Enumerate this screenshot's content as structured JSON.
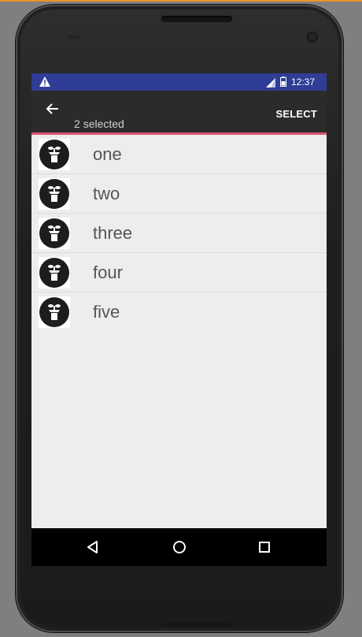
{
  "status_bar": {
    "time": "12:37",
    "warning_icon": "warning-icon",
    "signal_icon": "signal-icon",
    "battery_icon": "battery-icon",
    "background_color": "#2f3d97"
  },
  "action_bar": {
    "back_icon": "back-arrow-icon",
    "selected_count": "2",
    "selected_label": "selected",
    "select_label": "SELECT",
    "accent_color": "#e0536f"
  },
  "list": {
    "items": [
      {
        "label": "one",
        "icon": "plant-pot-icon"
      },
      {
        "label": "two",
        "icon": "plant-pot-icon"
      },
      {
        "label": "three",
        "icon": "plant-pot-icon"
      },
      {
        "label": "four",
        "icon": "plant-pot-icon"
      },
      {
        "label": "five",
        "icon": "plant-pot-icon"
      }
    ]
  },
  "nav_bar": {
    "back_icon": "nav-back-triangle-icon",
    "home_icon": "nav-home-circle-icon",
    "recents_icon": "nav-recents-square-icon"
  }
}
